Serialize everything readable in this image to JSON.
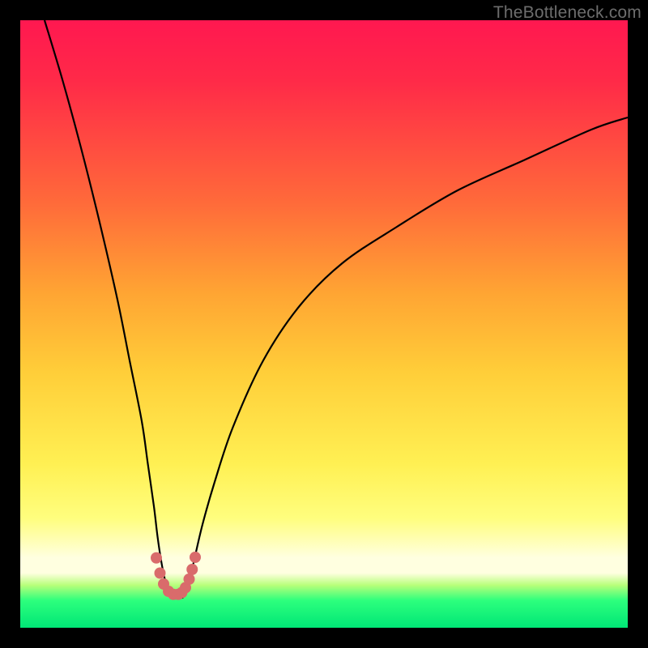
{
  "watermark": "TheBottleneck.com",
  "chart_data": {
    "type": "line",
    "title": "",
    "xlabel": "",
    "ylabel": "",
    "xlim": [
      0,
      100
    ],
    "ylim": [
      0,
      100
    ],
    "series": [
      {
        "name": "bottleneck-curve",
        "x": [
          4,
          7,
          10,
          13,
          16,
          18,
          20,
          21,
          22,
          22.6,
          23.2,
          23.8,
          24.5,
          25.2,
          25.8,
          26.3,
          26.8,
          27.3,
          27.9,
          28.6,
          30,
          32,
          35,
          40,
          46,
          53,
          62,
          72,
          83,
          94,
          100
        ],
        "values": [
          100,
          90,
          79,
          67,
          54,
          44,
          34,
          27,
          20,
          15,
          11,
          8,
          6,
          5,
          5,
          5,
          5,
          6,
          8,
          11,
          17,
          24,
          33,
          44,
          53,
          60,
          66,
          72,
          77,
          82,
          84
        ]
      }
    ],
    "markers": {
      "name": "highlight-points",
      "x": [
        22.4,
        23.0,
        23.6,
        24.4,
        25.2,
        26.0,
        26.6,
        27.2,
        27.8,
        28.3,
        28.8
      ],
      "values": [
        11.5,
        9.0,
        7.2,
        6.0,
        5.5,
        5.5,
        5.8,
        6.6,
        8.0,
        9.6,
        11.6
      ]
    },
    "gradient_stops": [
      {
        "pct": 0,
        "color": "#ff1850"
      },
      {
        "pct": 30,
        "color": "#ff6a3a"
      },
      {
        "pct": 58,
        "color": "#ffce39"
      },
      {
        "pct": 82,
        "color": "#fffe7e"
      },
      {
        "pct": 95.5,
        "color": "#2dff7d"
      },
      {
        "pct": 100,
        "color": "#00e676"
      }
    ]
  }
}
